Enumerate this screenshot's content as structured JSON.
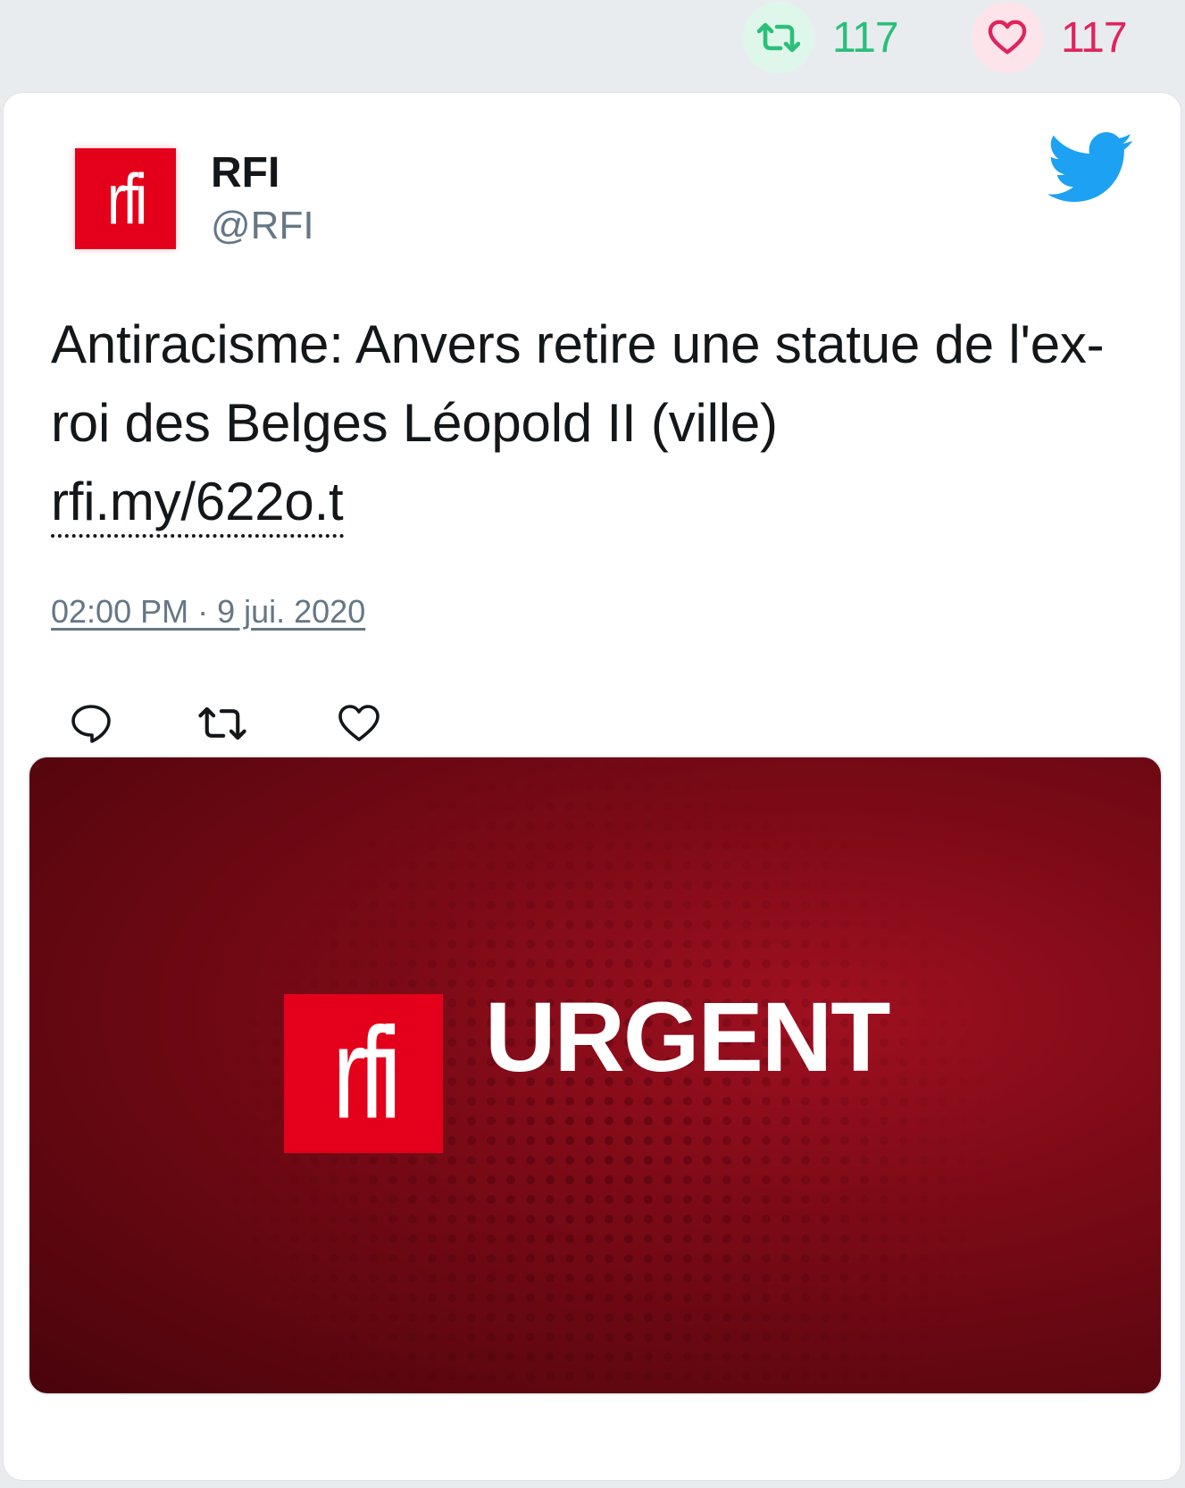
{
  "stats": {
    "retweets": "117",
    "likes": "117"
  },
  "tweet": {
    "author_name": "RFI",
    "author_handle": "@RFI",
    "avatar_text": "rfi",
    "text": "Antiracisme: Anvers retire une statue de l'ex-roi des Belges Léopold II (ville)",
    "link": "rfi.my/622o.t",
    "timestamp": "02:00 PM · 9 jui. 2020"
  },
  "media": {
    "logo_text": "rfi",
    "title": "URGENT"
  },
  "colors": {
    "retweet_green": "#2bbf7a",
    "like_red": "#e0245e",
    "twitter_blue": "#1da1f2",
    "rfi_red": "#e4001b"
  },
  "icons": {
    "retweet_stat": "retweet-icon",
    "like_stat": "heart-icon",
    "brand": "twitter-bird-icon",
    "reply_action": "reply-icon",
    "retweet_action": "retweet-icon",
    "like_action": "heart-icon"
  }
}
